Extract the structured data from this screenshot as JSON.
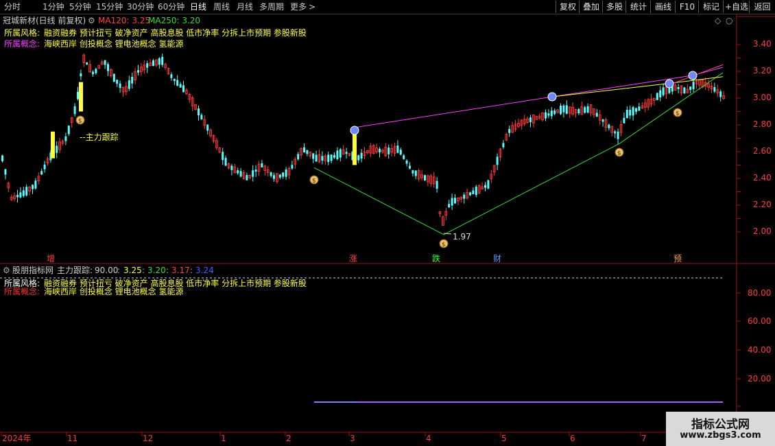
{
  "toolbar": {
    "timeframes": [
      "分时",
      "1分钟",
      "5分钟",
      "15分钟",
      "30分钟",
      "60分钟",
      "日线",
      "周线",
      "月线",
      "多周期",
      "更多"
    ],
    "more_arrow": ">",
    "active_timeframe": "日线",
    "buttons": [
      "复权",
      "叠加",
      "多股",
      "统计",
      "画线",
      "F10",
      "标记",
      "+自选",
      "返回"
    ]
  },
  "main_panel": {
    "stock_title": "冠城新材(日线 前复权)",
    "ma120_label": "MA120: 3.25",
    "ma250_label": "MA250: 3.20",
    "style_label": "所属风格:",
    "style_values": "融资融券 预计扭亏 破净资产 高股息股 低市净率 分拆上市预期 参股新股",
    "concept_label": "所属概念:",
    "concept_values": "海峡西岸 创投概念 锂电池概念 氢能源",
    "annotation_main_force": "--主力跟踪",
    "low_price_label": "1.97",
    "price_axis": [
      "3.40",
      "3.20",
      "3.00",
      "2.80",
      "2.60",
      "2.40",
      "2.20",
      "2.00"
    ],
    "event_markers": [
      "增",
      "涨",
      "跌",
      "财",
      "预"
    ]
  },
  "sub_panel": {
    "indicator_source": "股朋指标网",
    "indicator_name": "主力跟踪:",
    "values": [
      "90.00",
      "3.25",
      "3.20",
      "3.17",
      "3.24"
    ],
    "style_label": "所属风格:",
    "style_values": "融资融券 预计扭亏 破净资产 高股息股 低市净率 分拆上市预期 参股新股",
    "concept_label": "所属概念:",
    "concept_values": "海峡西岸 创投概念 锂电池概念 氢能源",
    "axis": [
      "80.00",
      "60.00",
      "40.00",
      "20.00"
    ]
  },
  "time_axis": {
    "labels": [
      "2024年",
      "11",
      "12",
      "1",
      "2",
      "3",
      "4",
      "5",
      "6",
      "7"
    ]
  },
  "watermark": {
    "title": "指标公式网",
    "url": "www.zbgs3.com"
  },
  "colors": {
    "up": "#ff3c3c",
    "down": "#54ffff",
    "yellow": "#ffff40",
    "magenta": "#ff40ff",
    "green": "#33dd33",
    "grid_red": "#a01010"
  }
}
